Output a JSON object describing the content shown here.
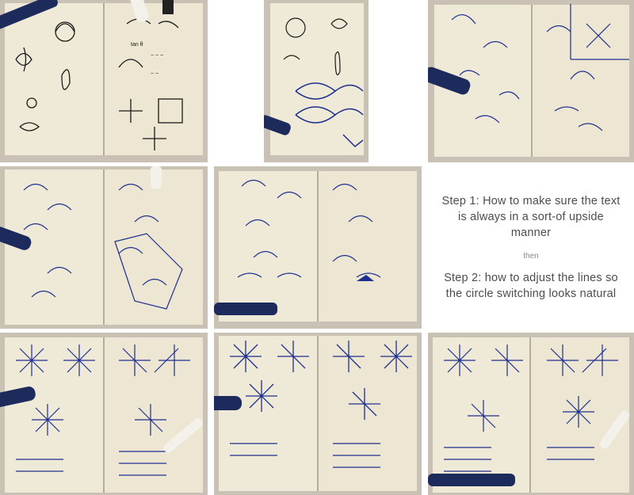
{
  "caption": {
    "step1": "Step 1: How to make sure the text is always in a sort-of upside manner",
    "connector": "then",
    "step2": "Step 2: how to adjust the lines so the circle switching looks natural"
  },
  "colors": {
    "paper": "#efe9d7",
    "ink": "#1f2f8f",
    "pen_body": "#1d2a5c",
    "background_table": "#c9c2b4"
  },
  "photos": [
    {
      "subject": "sketchbook-flower-sketches"
    },
    {
      "subject": "sketchbook-small-page-sketches"
    },
    {
      "subject": "sketchbook-arrow-diagrams"
    },
    {
      "subject": "sketchbook-circle-diagrams"
    },
    {
      "subject": "sketchbook-arrow-notes"
    },
    {
      "subject": "sketchbook-star-diagrams-1"
    },
    {
      "subject": "sketchbook-star-diagrams-2"
    },
    {
      "subject": "sketchbook-star-diagrams-3"
    }
  ]
}
